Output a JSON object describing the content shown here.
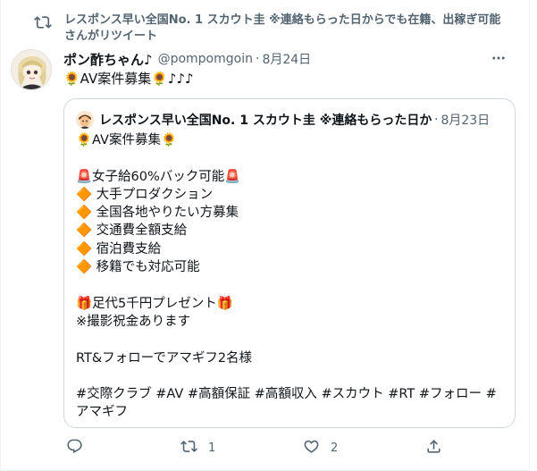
{
  "retweet": {
    "text": "レスポンス早い全国No. 1 スカウト圭 ※連絡もらった日からでも在籍、出稼ぎ可能さんがリツイート",
    "icon": "retweet-icon"
  },
  "tweet": {
    "display_name": "ポン酢ちゃん♪",
    "handle": "@pompomgoin",
    "separator": "·",
    "date": "8月24日",
    "text": "🌻AV案件募集🌻♪♪♪"
  },
  "quote": {
    "display_name": "レスポンス早い全国No. 1 スカウト圭 ※連絡もらった日か",
    "separator": "·",
    "date": "8月23日",
    "lines": [
      "🌻AV案件募集🌻",
      "",
      "🚨女子給60%バック可能🚨",
      "🔶 大手プロダクション",
      "🔶 全国各地やりたい方募集",
      "🔶 交通費全額支給",
      "🔶 宿泊費支給",
      "🔶 移籍でも対応可能",
      "",
      "🎁足代5千円プレゼント🎁",
      "※撮影祝金あります",
      "",
      "RT&フォローでアマギフ2名様",
      "",
      "#交際クラブ #AV #高額保証 #高額収入 #スカウト #RT #フォロー #アマギフ"
    ]
  },
  "actions": {
    "reply": {
      "icon": "reply-icon",
      "count": ""
    },
    "retweet": {
      "icon": "retweet-icon",
      "count": "1"
    },
    "like": {
      "icon": "heart-icon",
      "count": "2"
    },
    "share": {
      "icon": "share-icon",
      "count": ""
    }
  },
  "colors": {
    "text": "#0f1419",
    "secondary": "#536471",
    "border": "#cfd9de"
  }
}
